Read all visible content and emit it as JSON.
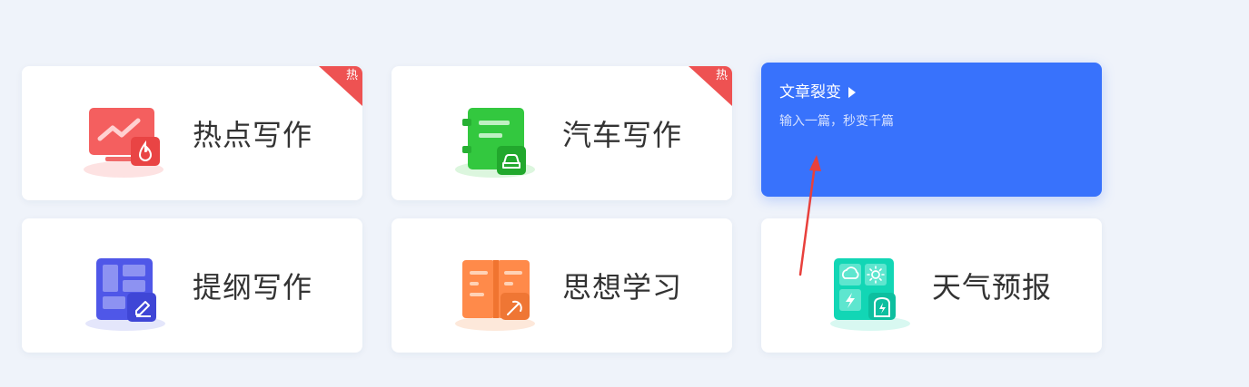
{
  "cards": [
    {
      "label": "热点写作",
      "badge": "热",
      "icon": "monitor-trend-icon",
      "color": "#f05a5a"
    },
    {
      "label": "汽车写作",
      "badge": "热",
      "icon": "notebook-car-icon",
      "color": "#2ec13b"
    },
    {
      "label": "提纲写作",
      "icon": "outline-layout-icon",
      "color": "#4f57e8"
    },
    {
      "label": "思想学习",
      "icon": "open-book-icon",
      "color": "#ff8a4a"
    },
    {
      "label": "天气预报",
      "icon": "weather-grid-icon",
      "color": "#12d6b5"
    }
  ],
  "feature": {
    "title": "文章裂变",
    "subtitle": "输入一篇，秒变千篇",
    "color": "#3872fc"
  },
  "annotation": {
    "arrow_color": "#e8403c"
  }
}
